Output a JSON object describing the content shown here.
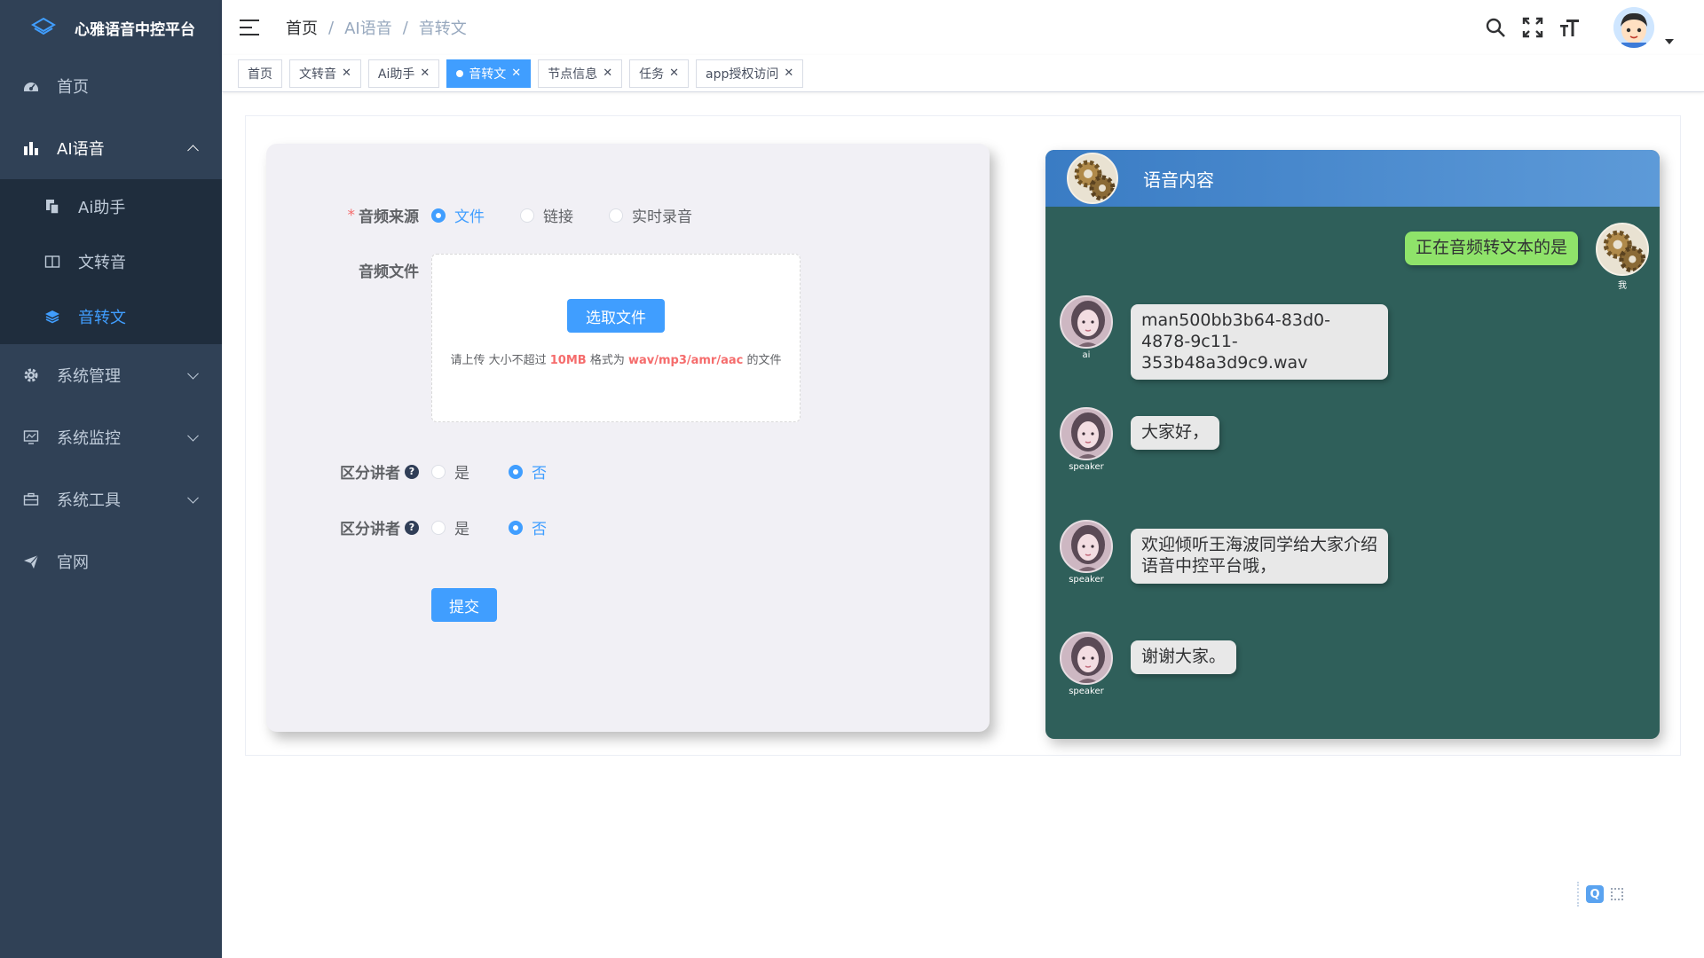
{
  "app": {
    "title": "心雅语音中控平台"
  },
  "sidebar": {
    "items": [
      {
        "label": "首页",
        "icon": "dashboard-icon"
      },
      {
        "label": "AI语音",
        "icon": "bar-chart-icon",
        "expanded": true,
        "children": [
          {
            "label": "Ai助手",
            "icon": "copy-icon"
          },
          {
            "label": "文转音",
            "icon": "book-icon"
          },
          {
            "label": "音转文",
            "icon": "layers-icon",
            "active": true
          }
        ]
      },
      {
        "label": "系统管理",
        "icon": "gear-icon"
      },
      {
        "label": "系统监控",
        "icon": "monitor-icon"
      },
      {
        "label": "系统工具",
        "icon": "toolbox-icon"
      },
      {
        "label": "官网",
        "icon": "send-icon"
      }
    ]
  },
  "navbar": {
    "breadcrumb": [
      "首页",
      "AI语音",
      "音转文"
    ]
  },
  "tags": [
    {
      "label": "首页",
      "closable": false
    },
    {
      "label": "文转音",
      "closable": true
    },
    {
      "label": "Ai助手",
      "closable": true
    },
    {
      "label": "音转文",
      "closable": true,
      "active": true
    },
    {
      "label": "节点信息",
      "closable": true
    },
    {
      "label": "任务",
      "closable": true
    },
    {
      "label": "app授权访问",
      "closable": true
    }
  ],
  "form": {
    "source": {
      "label": "音频来源",
      "required": "*",
      "options": [
        "文件",
        "链接",
        "实时录音"
      ],
      "selected": "文件"
    },
    "file": {
      "label": "音频文件",
      "button": "选取文件",
      "tip_prefix": "请上传 大小不超过 ",
      "tip_size": "10MB",
      "tip_mid": " 格式为 ",
      "tip_formats": "wav/mp3/amr/aac",
      "tip_suffix": " 的文件"
    },
    "speaker1": {
      "label": "区分讲者",
      "help": "?",
      "options": [
        "是",
        "否"
      ],
      "selected": "否"
    },
    "speaker2": {
      "label": "区分讲者",
      "help": "?",
      "options": [
        "是",
        "否"
      ],
      "selected": "否"
    },
    "submit": "提交"
  },
  "chat": {
    "title": "语音内容",
    "messages": [
      {
        "from": "me",
        "name": "我",
        "text": "正在音频转文本的是"
      },
      {
        "from": "ai",
        "name": "ai",
        "text": "man500bb3b64-83d0-4878-9c11-353b48a3d9c9.wav"
      },
      {
        "from": "speaker",
        "name": "speaker",
        "text": "大家好，"
      },
      {
        "from": "speaker",
        "name": "speaker",
        "text": "欢迎倾听王海波同学给大家介绍语音中控平台哦，"
      },
      {
        "from": "speaker",
        "name": "speaker",
        "text": "谢谢大家。"
      }
    ]
  },
  "float_tool": {
    "label": "Q"
  },
  "colors": {
    "sidebar": "#304156",
    "submenu": "#1f2d3d",
    "primary": "#409eff",
    "chat_bg": "#2f5f5a",
    "me_bubble": "#8fe36a"
  }
}
